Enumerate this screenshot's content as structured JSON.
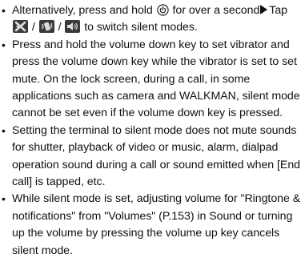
{
  "notes": [
    {
      "part1": "Alternatively, press and hold ",
      "part2": " for over a second",
      "part3": "Tap ",
      "part4": " / ",
      "part5": " / ",
      "part6": " to switch silent modes."
    },
    {
      "text": "Press and hold the volume down key to set vibrator and press the volume down key while the vibrator is set to set mute. On the lock screen, during a call, in some applications such as camera and WALKMAN, silent mode cannot be set even if the volume down key is pressed."
    },
    {
      "text": "Setting the terminal to silent mode does not mute sounds for shutter, playback of video or music, alarm, dialpad operation sound during a call or sound emitted when [End call] is tapped, etc."
    },
    {
      "text": "While silent mode is set, adjusting volume for \"Ringtone & notifications\" from \"Volumes\" (P.153) in Sound or turning up the volume by pressing the volume up key cancels silent mode."
    }
  ],
  "bullet": "•",
  "icons": {
    "power": "power-button-icon",
    "mute": "mute-icon",
    "vibrate": "vibrate-icon",
    "sound_on": "sound-on-icon"
  }
}
